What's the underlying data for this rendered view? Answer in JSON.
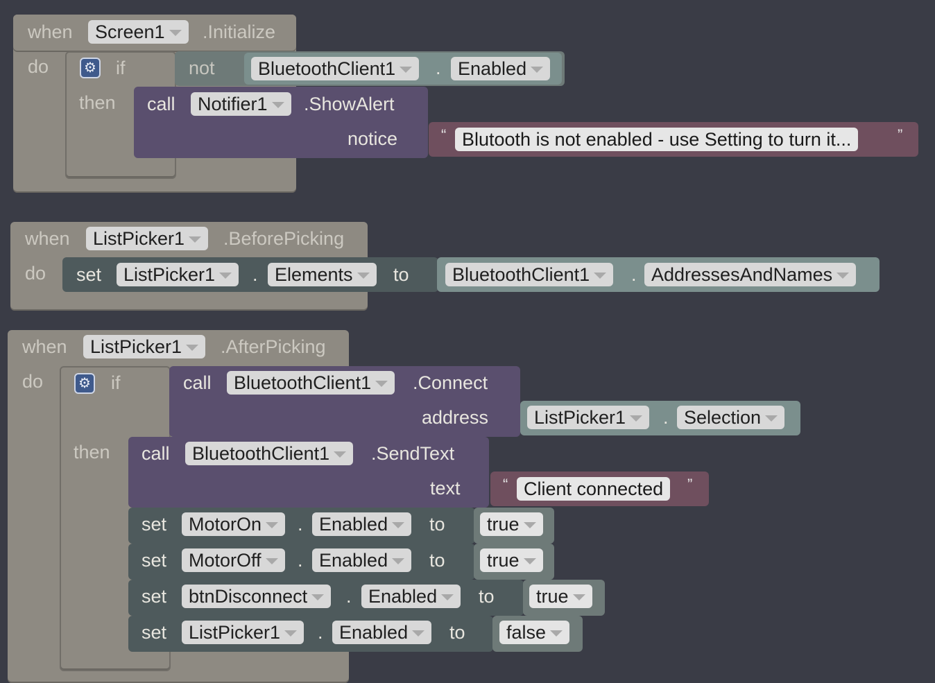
{
  "keywords": {
    "when": "when",
    "do": "do",
    "if": "if",
    "then": "then",
    "not": "not",
    "call": "call",
    "set": "set",
    "to": "to",
    "dot": "."
  },
  "block1": {
    "component": "Screen1",
    "event": ".Initialize",
    "condition": {
      "component": "BluetoothClient1",
      "property": "Enabled"
    },
    "alert": {
      "component": "Notifier1",
      "method": ".ShowAlert",
      "param": "notice",
      "value": "Blutooth is not enabled - use Setting to turn it..."
    }
  },
  "block2": {
    "component": "ListPicker1",
    "event": ".BeforePicking",
    "set": {
      "component": "ListPicker1",
      "property": "Elements",
      "src_component": "BluetoothClient1",
      "src_property": "AddressesAndNames"
    }
  },
  "block3": {
    "component": "ListPicker1",
    "event": ".AfterPicking",
    "connect": {
      "component": "BluetoothClient1",
      "method": ".Connect",
      "param": "address",
      "arg_component": "ListPicker1",
      "arg_property": "Selection"
    },
    "send": {
      "component": "BluetoothClient1",
      "method": ".SendText",
      "param": "text",
      "value": "Client connected"
    },
    "sets": [
      {
        "component": "MotorOn",
        "property": "Enabled",
        "value": "true"
      },
      {
        "component": "MotorOff",
        "property": "Enabled",
        "value": "true"
      },
      {
        "component": "btnDisconnect",
        "property": "Enabled",
        "value": "true"
      },
      {
        "component": "ListPicker1",
        "property": "Enabled",
        "value": "false"
      }
    ]
  },
  "colors": {
    "workspace": "#3a3c46",
    "event": "#8e8a82",
    "call": "#5a4f6e",
    "set": "#4e5a5c",
    "component": "#7b8f8d",
    "text": "#6f4f5e",
    "logic": "#6e7a78"
  },
  "icons": [
    "gear-icon",
    "dropdown-arrow-icon"
  ]
}
